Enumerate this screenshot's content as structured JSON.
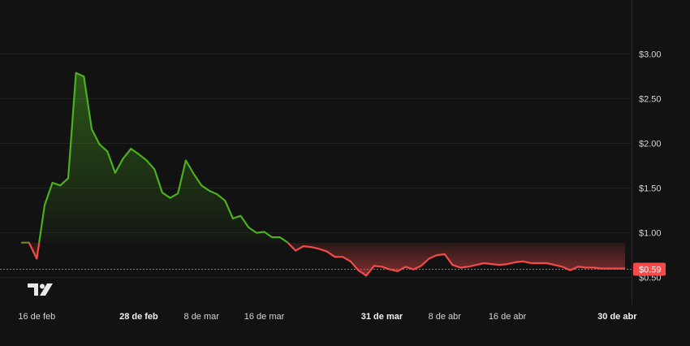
{
  "chart_data": {
    "type": "area",
    "title": "",
    "xlabel": "",
    "ylabel": "",
    "baseline_value": 0.88,
    "current_price": 0.59,
    "current_price_label": "$0.59",
    "ylim": [
      0.23,
      3.37
    ],
    "y_ticks": [
      {
        "value": 3.0,
        "label": "$3.00"
      },
      {
        "value": 2.5,
        "label": "$2.50"
      },
      {
        "value": 2.0,
        "label": "$2.00"
      },
      {
        "value": 1.5,
        "label": "$1.50"
      },
      {
        "value": 1.0,
        "label": "$1.00"
      },
      {
        "value": 0.5,
        "label": "$0.50"
      }
    ],
    "x_range": [
      "2025-02-13",
      "2025-05-01"
    ],
    "x_ticks": [
      {
        "date": "2025-02-15",
        "label": "16 de feb",
        "bold": false
      },
      {
        "date": "2025-02-28",
        "label": "28 de feb",
        "bold": true
      },
      {
        "date": "2025-03-08",
        "label": "8 de mar",
        "bold": false
      },
      {
        "date": "2025-03-16",
        "label": "16 de mar",
        "bold": false
      },
      {
        "date": "2025-03-31",
        "label": "31 de mar",
        "bold": true
      },
      {
        "date": "2025-04-08",
        "label": "8 de abr",
        "bold": false
      },
      {
        "date": "2025-04-16",
        "label": "16 de abr",
        "bold": false
      },
      {
        "date": "2025-04-30",
        "label": "30 de abr",
        "bold": true
      }
    ],
    "series": [
      {
        "x": [
          "2025-02-13",
          "2025-02-14",
          "2025-02-15",
          "2025-02-16",
          "2025-02-17",
          "2025-02-18",
          "2025-02-19",
          "2025-02-20",
          "2025-02-21",
          "2025-02-22",
          "2025-02-23",
          "2025-02-24",
          "2025-02-25",
          "2025-02-26",
          "2025-02-27",
          "2025-02-28",
          "2025-03-01",
          "2025-03-02",
          "2025-03-03",
          "2025-03-04",
          "2025-03-05",
          "2025-03-06",
          "2025-03-07",
          "2025-03-08",
          "2025-03-09",
          "2025-03-10",
          "2025-03-11",
          "2025-03-12",
          "2025-03-13",
          "2025-03-14",
          "2025-03-15",
          "2025-03-16",
          "2025-03-17",
          "2025-03-18",
          "2025-03-19",
          "2025-03-20",
          "2025-03-21",
          "2025-03-22",
          "2025-03-23",
          "2025-03-24",
          "2025-03-25",
          "2025-03-26",
          "2025-03-27",
          "2025-03-28",
          "2025-03-29",
          "2025-03-30",
          "2025-03-31",
          "2025-04-01",
          "2025-04-02",
          "2025-04-03",
          "2025-04-04",
          "2025-04-05",
          "2025-04-06",
          "2025-04-07",
          "2025-04-08",
          "2025-04-09",
          "2025-04-10",
          "2025-04-11",
          "2025-04-12",
          "2025-04-13",
          "2025-04-14",
          "2025-04-15",
          "2025-04-16",
          "2025-04-17",
          "2025-04-18",
          "2025-04-19",
          "2025-04-20",
          "2025-04-21",
          "2025-04-22",
          "2025-04-23",
          "2025-04-24",
          "2025-04-25",
          "2025-04-26",
          "2025-04-27",
          "2025-04-28",
          "2025-04-29",
          "2025-04-30",
          "2025-05-01"
        ],
        "values": [
          0.88,
          0.88,
          0.7,
          1.3,
          1.55,
          1.52,
          1.6,
          2.78,
          2.74,
          2.15,
          1.98,
          1.9,
          1.66,
          1.82,
          1.93,
          1.87,
          1.8,
          1.7,
          1.44,
          1.38,
          1.43,
          1.8,
          1.65,
          1.52,
          1.46,
          1.42,
          1.35,
          1.15,
          1.18,
          1.05,
          0.99,
          1.0,
          0.94,
          0.94,
          0.88,
          0.79,
          0.84,
          0.83,
          0.81,
          0.78,
          0.72,
          0.72,
          0.67,
          0.57,
          0.51,
          0.62,
          0.61,
          0.58,
          0.56,
          0.61,
          0.58,
          0.62,
          0.7,
          0.74,
          0.75,
          0.63,
          0.6,
          0.61,
          0.63,
          0.65,
          0.64,
          0.63,
          0.64,
          0.66,
          0.67,
          0.65,
          0.65,
          0.65,
          0.63,
          0.61,
          0.57,
          0.61,
          0.6,
          0.6,
          0.59,
          0.59,
          0.59,
          0.59
        ]
      }
    ],
    "colors": {
      "up": "#4CAF1F",
      "down": "#F44A4A",
      "background": "#121212",
      "grid": "#222222",
      "axis_text": "#D5D5D5",
      "price_label_bg": "#F44A4A",
      "price_label_text": "#FFFFFF"
    },
    "grid": true,
    "logo": "tradingview-logo-icon"
  }
}
